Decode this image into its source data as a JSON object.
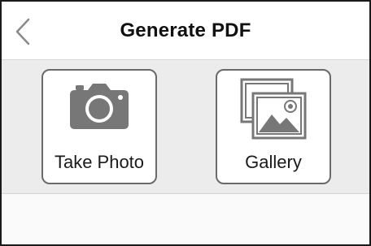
{
  "header": {
    "title": "Generate PDF",
    "back_icon": "chevron-left-icon"
  },
  "options": [
    {
      "label": "Take Photo",
      "icon": "camera-icon"
    },
    {
      "label": "Gallery",
      "icon": "gallery-icon"
    }
  ],
  "colors": {
    "header_bg": "#ffffff",
    "content_bg": "#ececec",
    "tile_border": "#6a6a6a",
    "icon": "#777777"
  }
}
